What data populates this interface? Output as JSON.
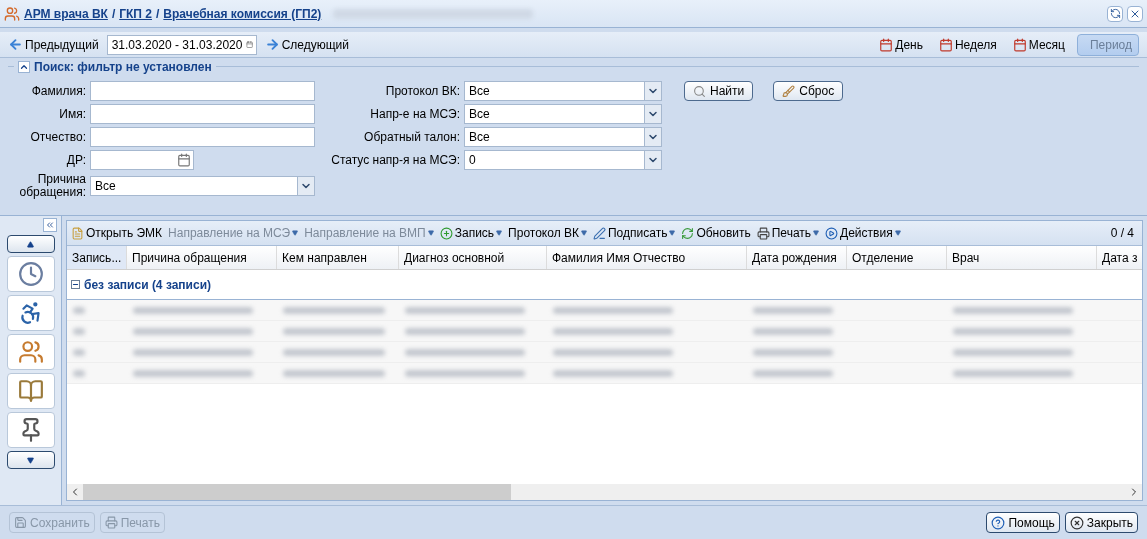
{
  "window": {
    "breadcrumbs": [
      {
        "text": "АРМ врача ВК"
      },
      {
        "text": "ГКП 2"
      },
      {
        "text": "Врачебная комиссия (ГП2)"
      }
    ],
    "separator": "/",
    "title_redacted": true
  },
  "nav": {
    "prev": "Предыдущий",
    "date_range": "31.03.2020 - 31.03.2020",
    "next": "Следующий",
    "periods": [
      {
        "label": "День",
        "selected": false,
        "kind": "calendar"
      },
      {
        "label": "Неделя",
        "selected": false,
        "kind": "calendar"
      },
      {
        "label": "Месяц",
        "selected": false,
        "kind": "calendar"
      },
      {
        "label": "Период",
        "selected": true,
        "kind": "toggle"
      }
    ]
  },
  "filter": {
    "title": "Поиск: фильтр не установлен",
    "expanded": true,
    "left_fields": [
      {
        "label": "Фамилия:",
        "kind": "text"
      },
      {
        "label": "Имя:",
        "kind": "text"
      },
      {
        "label": "Отчество:",
        "kind": "text"
      },
      {
        "label": "ДР:",
        "kind": "date"
      },
      {
        "label": "Причина обращения:",
        "kind": "select",
        "value": "Все"
      }
    ],
    "right_fields": [
      {
        "label": "Протокол ВК:",
        "kind": "select",
        "value": "Все"
      },
      {
        "label": "Напр-е на МСЭ:",
        "kind": "select",
        "value": "Все"
      },
      {
        "label": "Обратный талон:",
        "kind": "select",
        "value": "Все"
      },
      {
        "label": "Статус напр-я на МСЭ:",
        "kind": "select",
        "value": "0"
      }
    ],
    "find_button": "Найти",
    "reset_button": "Сброс"
  },
  "grid": {
    "toolbar": [
      {
        "label": "Открыть ЭМК",
        "kind": "button",
        "disabled": false
      },
      {
        "label": "Направление на МСЭ",
        "kind": "menu",
        "disabled": true
      },
      {
        "label": "Направление на ВМП",
        "kind": "menu",
        "disabled": true
      },
      {
        "label": "Запись",
        "kind": "menu",
        "disabled": false
      },
      {
        "label": "Протокол ВК",
        "kind": "menu",
        "disabled": false
      },
      {
        "label": "Подписать",
        "kind": "menu",
        "disabled": false
      },
      {
        "label": "Обновить",
        "kind": "button",
        "disabled": false
      },
      {
        "label": "Печать",
        "kind": "menu",
        "disabled": false
      },
      {
        "label": "Действия",
        "kind": "menu",
        "disabled": false
      }
    ],
    "counter": "0 / 4",
    "columns": [
      "Запись...",
      "Причина обращения",
      "Кем направлен",
      "Диагноз основной",
      "Фамилия Имя Отчество",
      "Дата рождения",
      "Отделение",
      "Врач",
      "Дата з"
    ],
    "group": {
      "label": "без записи (4 записи)",
      "expanded": true
    },
    "rows": [
      {
        "redacted": true
      },
      {
        "redacted": true
      },
      {
        "redacted": true
      },
      {
        "redacted": true
      }
    ]
  },
  "footer": {
    "left_buttons": [
      {
        "label": "Сохранить",
        "disabled": true
      },
      {
        "label": "Печать",
        "disabled": true
      }
    ],
    "right_buttons": [
      {
        "label": "Помощь",
        "disabled": false
      },
      {
        "label": "Закрыть",
        "disabled": false
      }
    ]
  }
}
